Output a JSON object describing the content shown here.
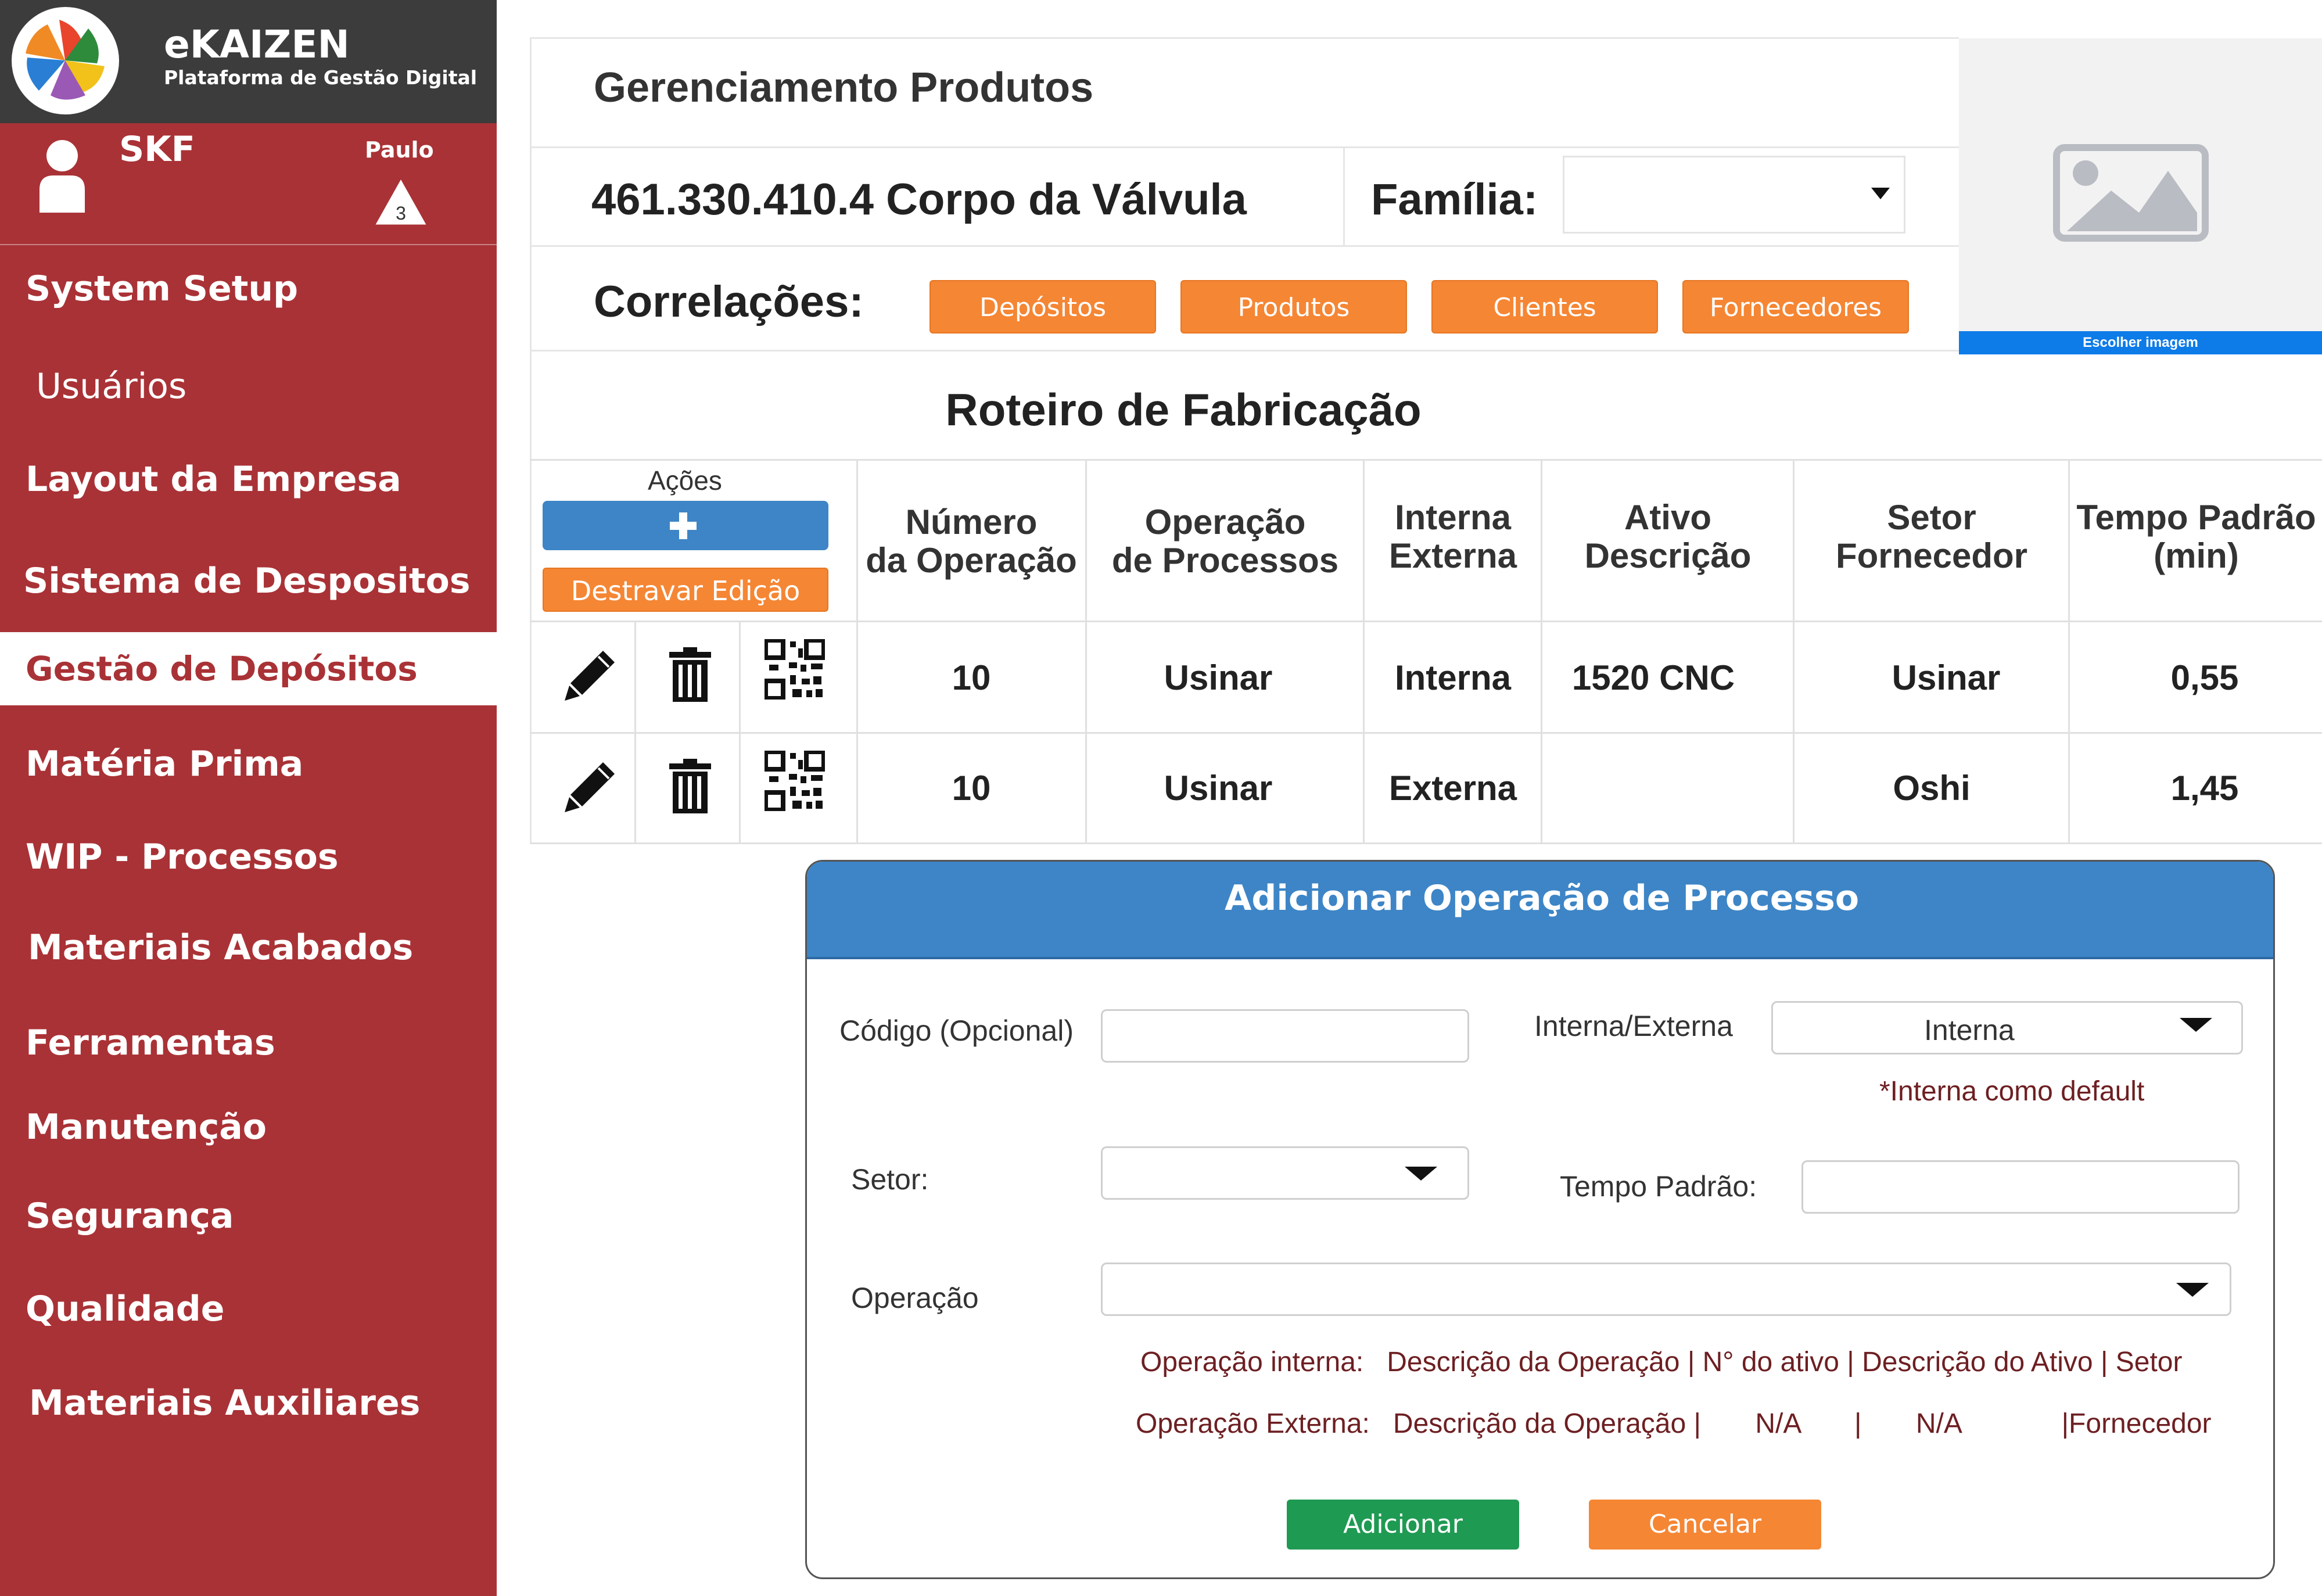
{
  "app": {
    "title": "eKAIZEN",
    "subtitle": "Plataforma de Gestão Digital"
  },
  "user": {
    "company": "SKF",
    "name": "Paulo",
    "level": "3"
  },
  "sidebar": {
    "items": [
      {
        "label": "System Setup"
      },
      {
        "label": "Usuários"
      },
      {
        "label": "Layout da Empresa"
      },
      {
        "label": "Sistema de Despositos"
      },
      {
        "label": "Gestão de Depósitos"
      },
      {
        "label": "Matéria Prima"
      },
      {
        "label": "WIP - Processos"
      },
      {
        "label": "Materiais Acabados"
      },
      {
        "label": "Ferramentas"
      },
      {
        "label": "Manutenção"
      },
      {
        "label": "Segurança"
      },
      {
        "label": "Qualidade"
      },
      {
        "label": "Materiais Auxiliares"
      }
    ]
  },
  "header": {
    "title": "Gerenciamento  Produtos",
    "product": "461.330.410.4  Corpo da Válvula",
    "familia_label": "Família:",
    "familia_value": "",
    "correlacoes_label": "Correlações:",
    "correlation_buttons": [
      "Depósitos",
      "Produtos",
      "Clientes",
      "Fornecedores"
    ],
    "choose_image": "Escolher imagem"
  },
  "routing": {
    "title": "Roteiro de Fabricação",
    "actions_label": "Ações",
    "add_symbol": "+",
    "unlock_label": "Destravar Edição",
    "columns": [
      [
        "Número",
        "da Operação"
      ],
      [
        "Operação",
        "de Processos"
      ],
      [
        "Interna",
        "Externa"
      ],
      [
        "Ativo",
        "Descrição"
      ],
      [
        "Setor",
        "Fornecedor"
      ],
      [
        "Tempo Padrão",
        "(min)"
      ]
    ],
    "rows": [
      {
        "num": "10",
        "op": "Usinar",
        "ie": "Interna",
        "ativo": "1520 CNC",
        "setor": "Usinar",
        "tempo": "0,55"
      },
      {
        "num": "10",
        "op": "Usinar",
        "ie": "Externa",
        "ativo": "",
        "setor": "Oshi",
        "tempo": "1,45"
      }
    ]
  },
  "modal": {
    "title": "Adicionar Operação de Processo",
    "codigo_label": "Código (Opcional)",
    "codigo_value": "",
    "ie_label": "Interna/Externa",
    "ie_value": "Interna",
    "ie_note": "*Interna como default",
    "setor_label": "Setor:",
    "setor_value": "",
    "tempo_label": "Tempo Padrão:",
    "tempo_value": "",
    "operacao_label": "Operação",
    "operacao_value": "",
    "note_interna": "Operação interna:   Descrição da Operação | N° do ativo | Descrição do Ativo | Setor",
    "note_externa": "Operação Externa:   Descrição da Operação |       N/A       |       N/A             |Fornecedor",
    "add_label": "Adicionar",
    "cancel_label": "Cancelar"
  },
  "colors": {
    "sidebar": "#a93236",
    "brandbar": "#3c3c3c",
    "orange": "#f58634",
    "blue": "#3d85c6",
    "green": "#1f9a52"
  }
}
